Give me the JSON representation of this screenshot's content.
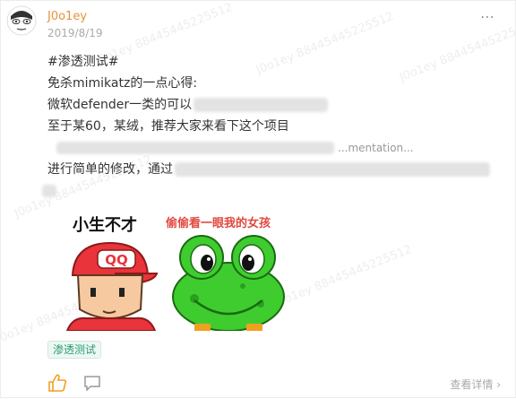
{
  "post": {
    "author": "J0o1ey",
    "date": "2019/8/19",
    "more_icon": "⋯",
    "lines": [
      "#渗透测试#",
      "免杀mimikatz的一点心得:",
      "微软defender一类的可以",
      "至于某60，某绒，推荐大家来看下这个项目",
      "...mentation...",
      "进行简单的修改，通过"
    ],
    "stickers": {
      "left_caption": "小生不才",
      "cap_text": "QQ",
      "right_caption": "偷偷看一眼我的女孩"
    },
    "tag": "渗透测试",
    "view_details": "查看详情",
    "arrow": "›"
  },
  "watermark": [
    "J0o1ey 88445445225512",
    "J0o1ey 88445445225512",
    "J0o1ey 88445445225512",
    "J0o1ey 88445445225512",
    "J0o1ey 88445445225512",
    "J0o1ey 88445445225512"
  ],
  "colors": {
    "author": "#e8913a",
    "tag": "#2a9b76",
    "right_caption": "#e0483d",
    "frog": "#3fcc2f"
  }
}
